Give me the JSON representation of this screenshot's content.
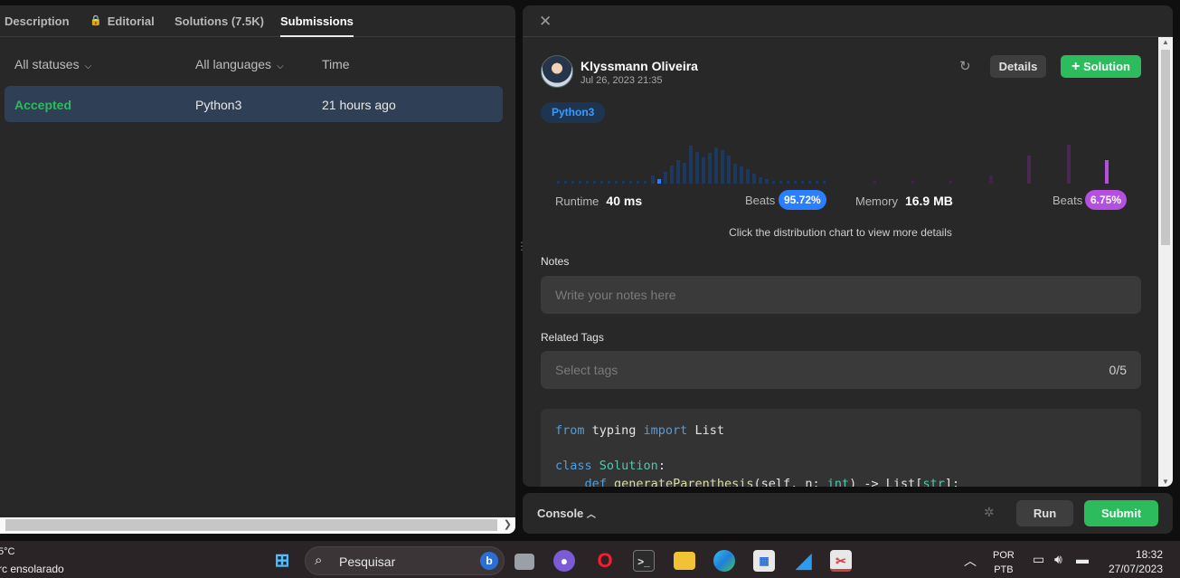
{
  "tabs": [
    "Description",
    "Editorial",
    "Solutions (7.5K)",
    "Submissions"
  ],
  "filters": {
    "status": "All statuses",
    "language": "All languages",
    "time": "Time"
  },
  "submission_row": {
    "status": "Accepted",
    "language": "Python3",
    "time": "21 hours ago"
  },
  "detail": {
    "user_name": "Klyssmann Oliveira",
    "date": "Jul 26, 2023 21:35",
    "details_label": "Details",
    "solution_label": "Solution",
    "language": "Python3",
    "runtime_label": "Runtime",
    "runtime_value": "40 ms",
    "runtime_beats_label": "Beats",
    "runtime_beats": "95.72%",
    "memory_label": "Memory",
    "memory_value": "16.9 MB",
    "memory_beats_label": "Beats",
    "memory_beats": "6.75%",
    "hint": "Click the distribution chart to view more details",
    "notes_label": "Notes",
    "notes_placeholder": "Write your notes here",
    "tags_label": "Related Tags",
    "tags_placeholder": "Select tags",
    "tags_count": "0/5"
  },
  "code_lines": [
    "from typing import List",
    "",
    "class Solution:",
    "    def generateParenthesis(self, n: int) -> List[str]:"
  ],
  "colors": {
    "accent_green": "#2cbb5d",
    "runtime_blue": "#2b7fff",
    "memory_purple": "#b44fe0"
  },
  "console": {
    "label": "Console",
    "run": "Run",
    "submit": "Submit"
  },
  "taskbar": {
    "weather_temp": "5°C",
    "weather_desc": "rc ensolarado",
    "search_placeholder": "Pesquisar",
    "lang_top": "POR",
    "lang_bottom": "PTB",
    "time": "18:32",
    "date": "27/07/2023"
  }
}
